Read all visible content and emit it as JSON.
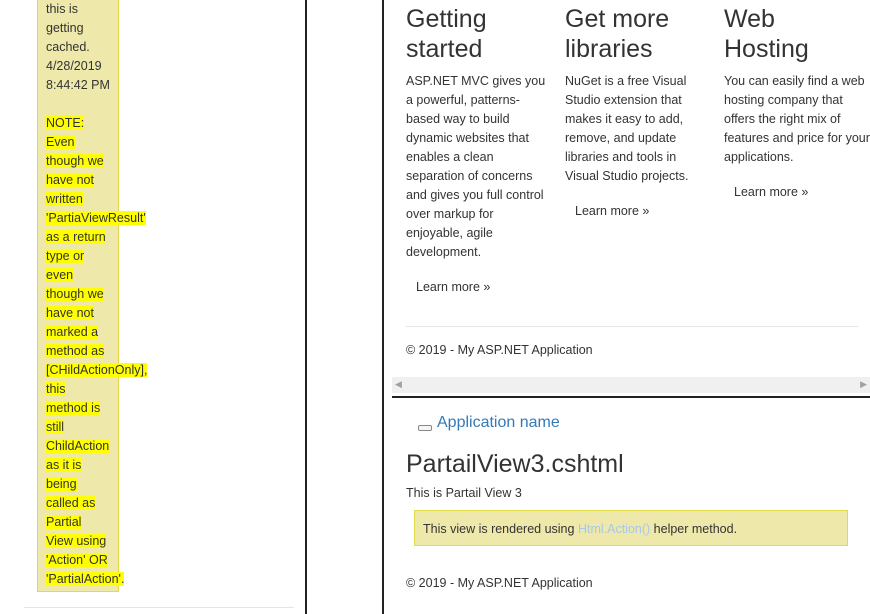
{
  "left": {
    "note_lines": [
      {
        "text": "this is",
        "hl": false
      },
      {
        "text": "getting",
        "hl": false
      },
      {
        "text": "cached.",
        "hl": false
      },
      {
        "text": "4/28/2019",
        "hl": false
      },
      {
        "text": "8:44:42 PM",
        "hl": false
      },
      {
        "text": "",
        "hl": false
      },
      {
        "text": "NOTE:",
        "hl": true
      },
      {
        "text": "Even",
        "hl": true
      },
      {
        "text": "though we",
        "hl": true
      },
      {
        "text": "have not",
        "hl": true
      },
      {
        "text": "written",
        "hl": true
      },
      {
        "text": "'PartiaViewResult'",
        "hl": true
      },
      {
        "text": "as a return",
        "hl": true
      },
      {
        "text": "type or",
        "hl": true
      },
      {
        "text": "even",
        "hl": true
      },
      {
        "text": "though we",
        "hl": true
      },
      {
        "text": "have not",
        "hl": true
      },
      {
        "text": "marked a",
        "hl": true
      },
      {
        "text": "method as",
        "hl": true
      },
      {
        "text": "[CHildActionOnly],",
        "hl": true
      },
      {
        "text": "this",
        "hl": true
      },
      {
        "text": "method is",
        "hl": true
      },
      {
        "text": "still",
        "hl": true
      },
      {
        "text": "ChildAction",
        "hl": true
      },
      {
        "text": "as it is",
        "hl": true
      },
      {
        "text": "being",
        "hl": true
      },
      {
        "text": "called as",
        "hl": true
      },
      {
        "text": "Partial",
        "hl": true
      },
      {
        "text": "View using",
        "hl": true
      },
      {
        "text": "'Action' OR",
        "hl": true
      },
      {
        "text": "'PartialAction'.",
        "hl": true
      }
    ]
  },
  "right": {
    "columns": [
      {
        "heading_line1": "Getting",
        "heading_line2": "started",
        "body": "ASP.NET MVC gives you a powerful, patterns-based way to build dynamic websites that enables a clean separation of concerns and gives you full control over markup for enjoyable, agile development.",
        "link": "Learn more »"
      },
      {
        "heading_line1": "Get more",
        "heading_line2": "libraries",
        "body": "NuGet is a free Visual Studio extension that makes it easy to add, remove, and update libraries and tools in Visual Studio projects.",
        "link": "Learn more »"
      },
      {
        "heading_line1": "Web",
        "heading_line2": "Hosting",
        "body": "You can easily find a web hosting company that offers the right mix of features and price for your applications.",
        "link": "Learn more »"
      }
    ],
    "footer": "© 2019 - My ASP.NET Application",
    "scroll_left_arrow": "◀",
    "scroll_right_arrow": "▶",
    "brand": "Application name",
    "partial_title": "PartailView3.cshtml",
    "partial_text": "This is Partail View 3",
    "alert_prefix": "This view is rendered using",
    "alert_code": "Html.Action()",
    "alert_suffix": "helper method.",
    "footer2": "© 2019 - My ASP.NET Application"
  }
}
